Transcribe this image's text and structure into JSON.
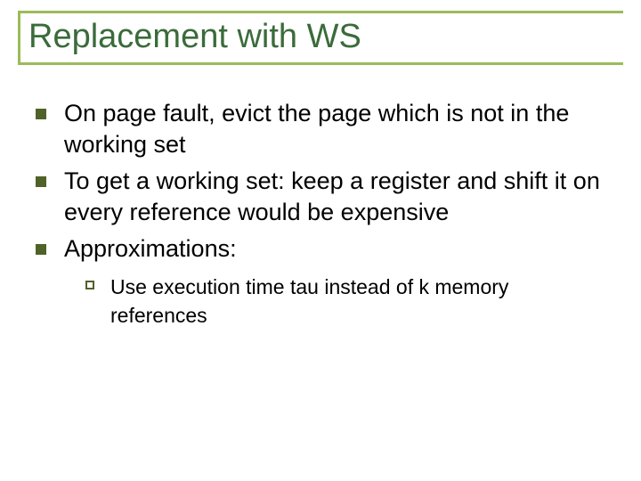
{
  "title": "Replacement with WS",
  "bullets": [
    {
      "text": "On page fault, evict the page which is not in the working set"
    },
    {
      "text": "To get a working set:  keep a register and shift it on every reference would be expensive"
    },
    {
      "text": "Approximations:"
    }
  ],
  "sub_bullets": [
    {
      "text": "Use execution time tau instead of k memory references"
    }
  ]
}
